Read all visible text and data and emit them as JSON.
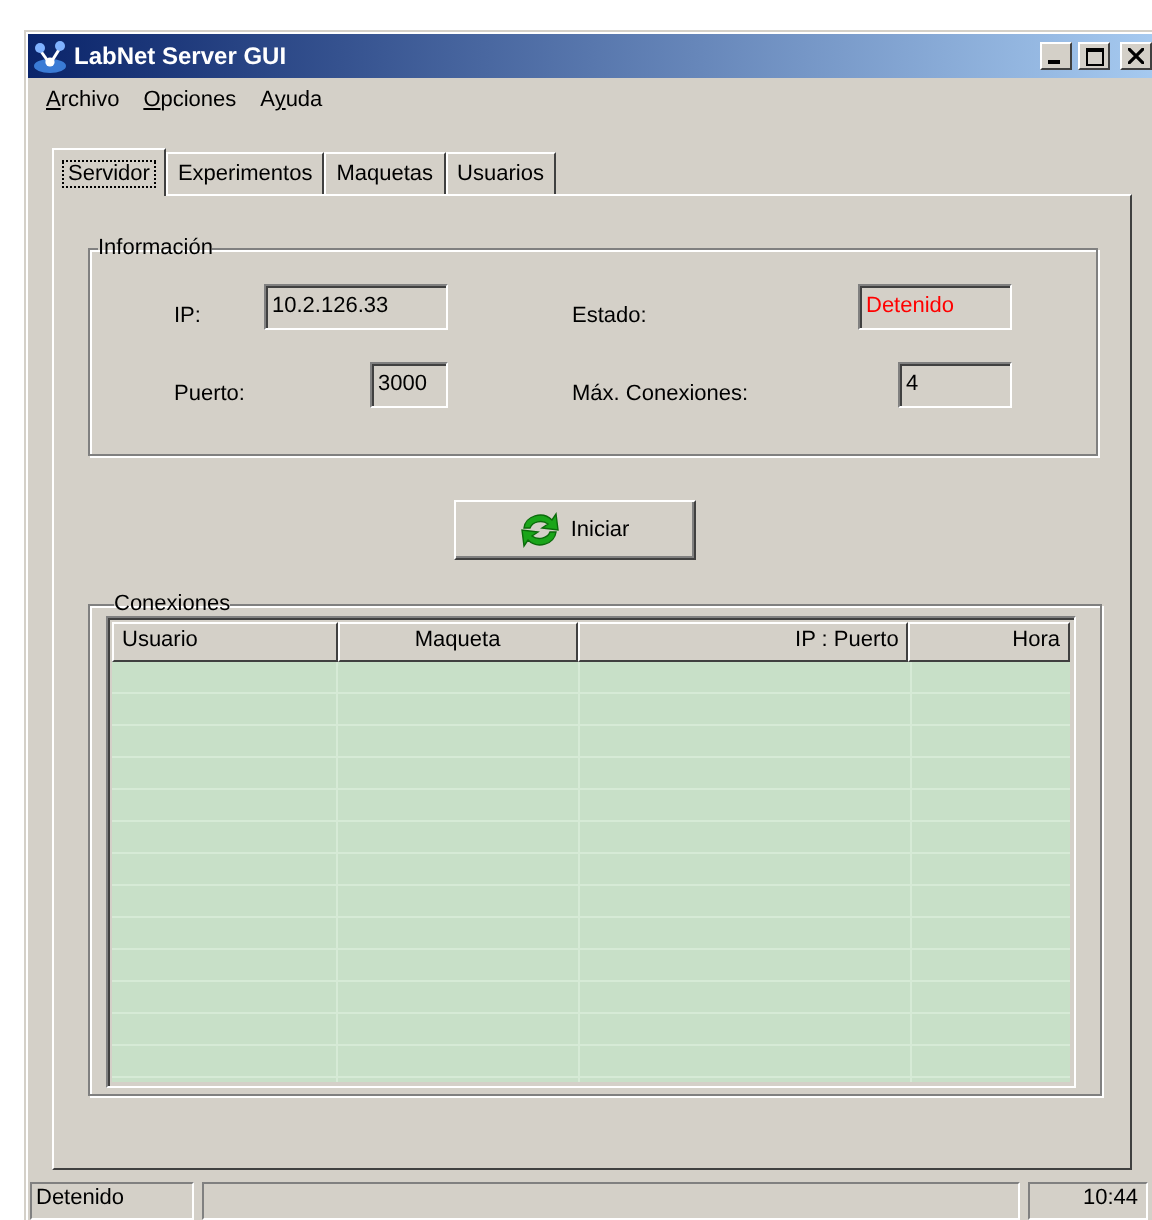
{
  "window": {
    "title": "LabNet Server GUI"
  },
  "menu": [
    {
      "label_parts": [
        {
          "text": "A",
          "access_key": true
        },
        {
          "text": "rchivo",
          "access_key": false
        }
      ]
    },
    {
      "label_parts": [
        {
          "text": "O",
          "access_key": true
        },
        {
          "text": "pciones",
          "access_key": false
        }
      ]
    },
    {
      "label_parts": [
        {
          "text": "A",
          "access_key": false
        },
        {
          "text": "y",
          "access_key": true
        },
        {
          "text": "uda",
          "access_key": false
        }
      ]
    }
  ],
  "tabs": [
    {
      "label": "Servidor",
      "selected": true
    },
    {
      "label": "Experimentos",
      "selected": false
    },
    {
      "label": "Maquetas",
      "selected": false
    },
    {
      "label": "Usuarios",
      "selected": false
    }
  ],
  "informacion": {
    "title": "Información",
    "ip": {
      "label": "IP:",
      "value": "10.2.126.33"
    },
    "estado": {
      "label": "Estado:",
      "value": "Detenido",
      "alert": true
    },
    "puerto": {
      "label": "Puerto:",
      "value": "3000"
    },
    "max_conexiones": {
      "label": "Máx. Conexiones:",
      "value": "4"
    }
  },
  "start_button": {
    "label": "Iniciar"
  },
  "conexiones": {
    "title": "Conexiones",
    "columns": [
      {
        "label": "Usuario"
      },
      {
        "label": "Maqueta"
      },
      {
        "label": "IP : Puerto"
      },
      {
        "label": "Hora"
      }
    ]
  },
  "status_bar": {
    "status": "Detenido",
    "time": "10:44"
  }
}
